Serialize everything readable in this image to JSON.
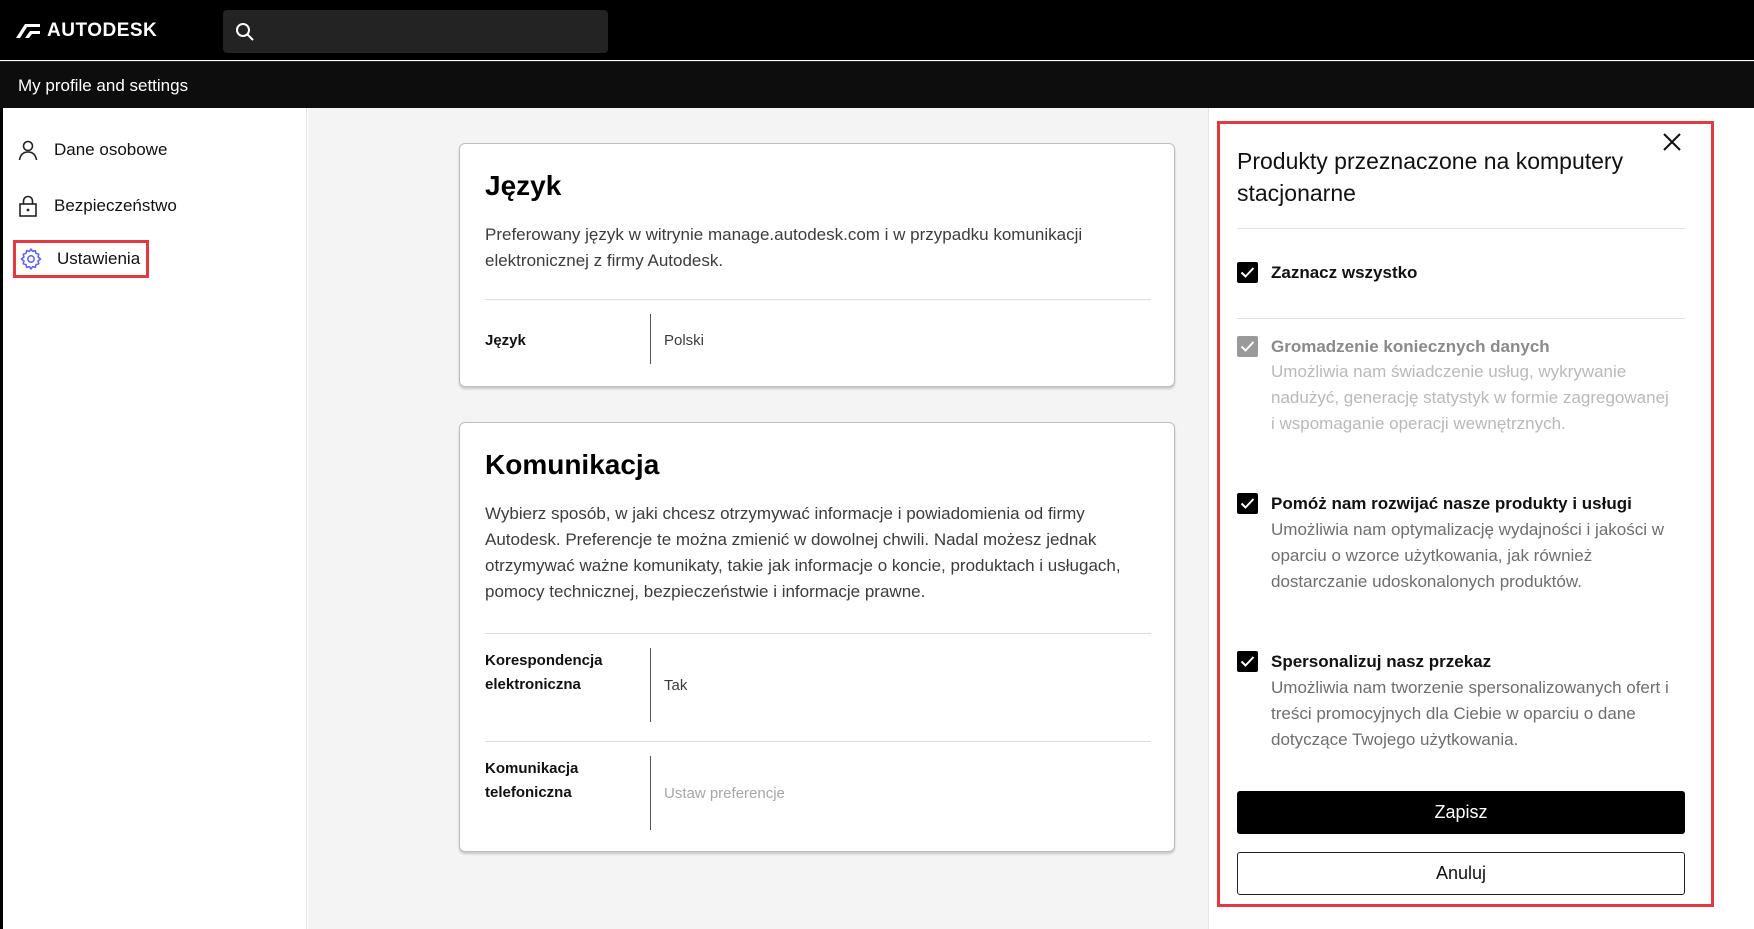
{
  "brand": {
    "name": "AUTODESK"
  },
  "search": {
    "placeholder": ""
  },
  "subheader": {
    "title": "My profile and settings"
  },
  "sidebar": {
    "items": [
      {
        "label": "Dane osobowe",
        "icon": "person-icon"
      },
      {
        "label": "Bezpieczeństwo",
        "icon": "lock-icon"
      },
      {
        "label": "Ustawienia",
        "icon": "gear-icon",
        "active": true
      }
    ]
  },
  "language_card": {
    "title": "Język",
    "description": "Preferowany język w witrynie manage.autodesk.com i w przypadku komunikacji elektronicznej z firmy Autodesk.",
    "rows": [
      {
        "label": "Język",
        "value": "Polski"
      }
    ]
  },
  "communication_card": {
    "title": "Komunikacja",
    "description": "Wybierz sposób, w jaki chcesz otrzymywać informacje i powiadomienia od firmy Autodesk. Preferencje te można zmienić w dowolnej chwili. Nadal możesz jednak otrzymywać ważne komunikaty, takie jak informacje o koncie, produktach i usługach, pomocy technicznej, bezpieczeństwie i informacje prawne.",
    "rows": [
      {
        "label": "Korespondencja elektroniczna",
        "value": "Tak"
      },
      {
        "label": "Komunikacja telefoniczna",
        "value": "Ustaw preferencje"
      }
    ]
  },
  "panel": {
    "title": "Produkty przeznaczone na komputery stacjonarne",
    "select_all": {
      "label": "Zaznacz wszystko",
      "checked": true
    },
    "options": [
      {
        "title": "Gromadzenie koniecznych danych",
        "description": "Umożliwia nam świadczenie usług, wykrywanie nadużyć, generację statystyk w formie zagregowanej i wspomaganie operacji wewnętrznych.",
        "checked": true,
        "disabled": true
      },
      {
        "title": "Pomóż nam rozwijać nasze produkty i usługi",
        "description": "Umożliwia nam optymalizację wydajności i jakości w oparciu o wzorce użytkowania, jak również dostarczanie udoskonalonych produktów.",
        "checked": true,
        "disabled": false
      },
      {
        "title": "Spersonalizuj nasz przekaz",
        "description": "Umożliwia nam tworzenie spersonalizowanych ofert i treści promocyjnych dla Ciebie w oparciu o dane dotyczące Twojego użytkowania.",
        "checked": true,
        "disabled": false
      }
    ],
    "save_label": "Zapisz",
    "cancel_label": "Anuluj"
  },
  "colors": {
    "highlight": "#e2383f",
    "accent": "#5a60ff",
    "primary": "#000000"
  }
}
